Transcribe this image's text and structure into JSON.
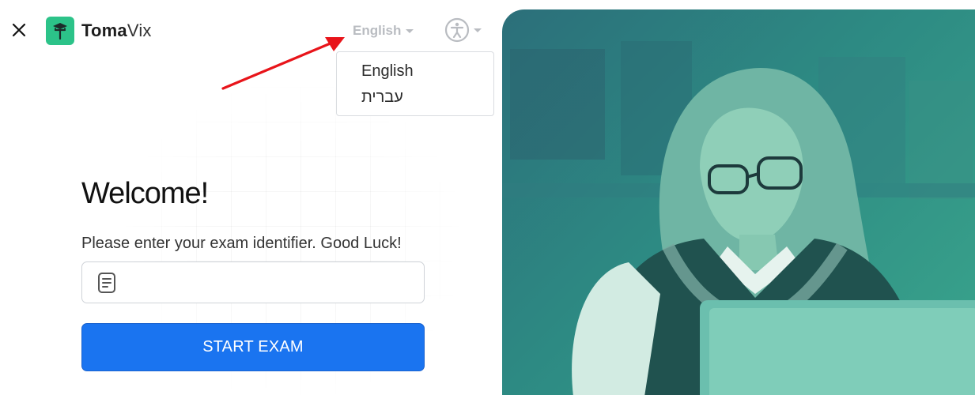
{
  "header": {
    "logo_bold": "Toma",
    "logo_regular": "Vix",
    "language_toggle": "English"
  },
  "language_menu": {
    "items": [
      "English",
      "עברית"
    ]
  },
  "main": {
    "title": "Welcome!",
    "subtitle": "Please enter your exam identifier. Good Luck!",
    "exam_input_value": "",
    "start_button": "START EXAM"
  },
  "colors": {
    "brand": "#2cc389",
    "primary_button": "#1a74f0",
    "annotation_arrow": "#e8141a",
    "hero_tint": "#2d8a83"
  },
  "icons": [
    "close-icon",
    "logo-icon",
    "chevron-down-icon",
    "accessibility-icon",
    "document-icon"
  ]
}
